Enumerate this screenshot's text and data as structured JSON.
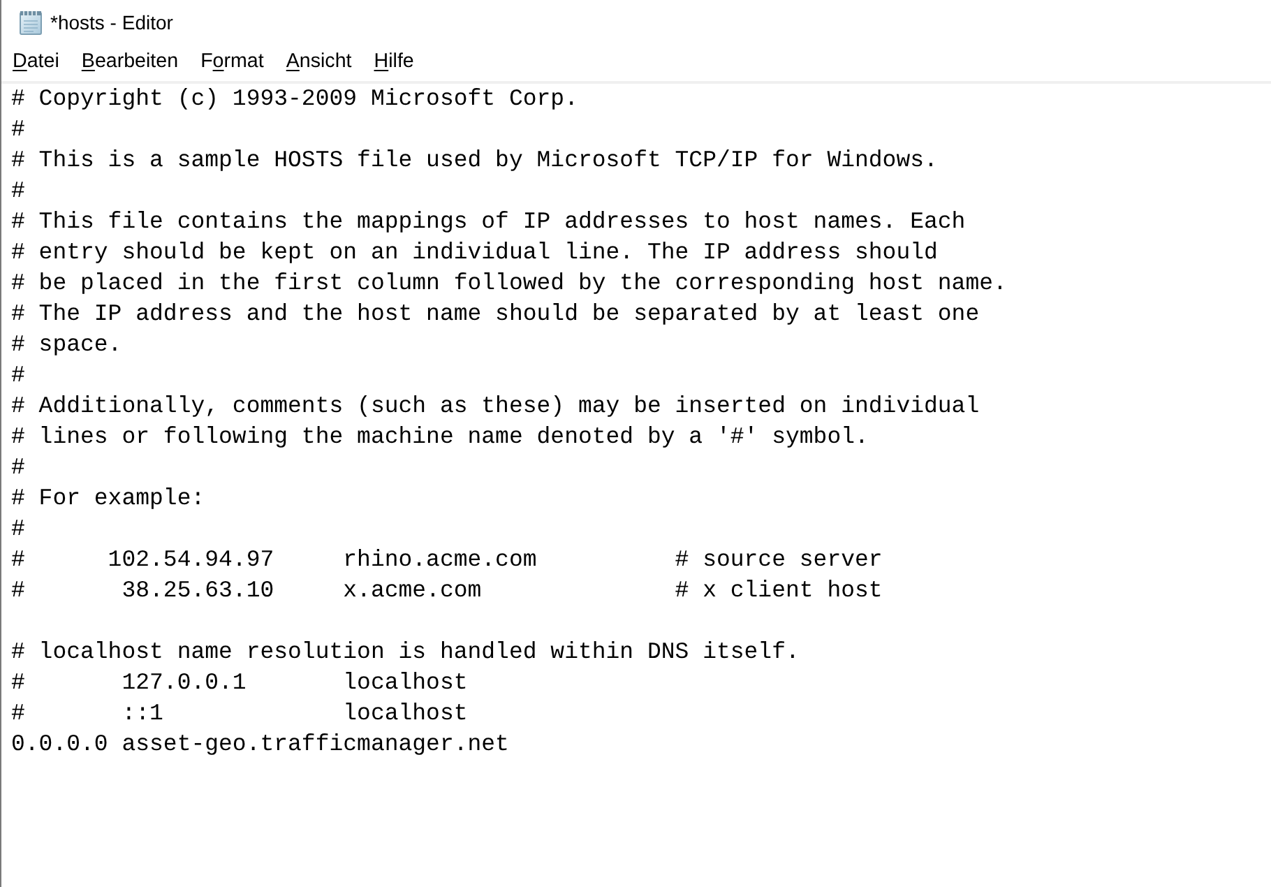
{
  "window": {
    "title": "*hosts - Editor"
  },
  "menu_bar": [
    {
      "access_key": "D",
      "after": "atei"
    },
    {
      "access_key": "B",
      "after": "earbeiten"
    },
    {
      "before": "F",
      "access_key": "o",
      "after": "rmat"
    },
    {
      "access_key": "A",
      "after": "nsicht"
    },
    {
      "access_key": "H",
      "after": "ilfe"
    }
  ],
  "editor": {
    "text": "# Copyright (c) 1993-2009 Microsoft Corp.\n#\n# This is a sample HOSTS file used by Microsoft TCP/IP for Windows.\n#\n# This file contains the mappings of IP addresses to host names. Each\n# entry should be kept on an individual line. The IP address should\n# be placed in the first column followed by the corresponding host name.\n# The IP address and the host name should be separated by at least one\n# space.\n#\n# Additionally, comments (such as these) may be inserted on individual\n# lines or following the machine name denoted by a '#' symbol.\n#\n# For example:\n#\n#      102.54.94.97     rhino.acme.com          # source server\n#       38.25.63.10     x.acme.com              # x client host\n\n# localhost name resolution is handled within DNS itself.\n#       127.0.0.1       localhost\n#       ::1             localhost\n0.0.0.0 asset-geo.trafficmanager.net"
  }
}
